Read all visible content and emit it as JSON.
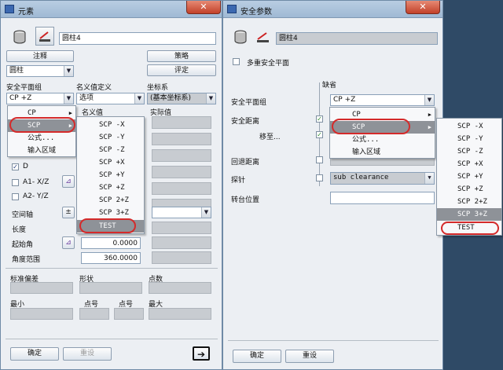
{
  "left_window": {
    "title": "元素",
    "close": "✕",
    "element_name": "圆柱4",
    "btn_note": "注释",
    "btn_strategy": "策略",
    "btn_eval": "评定",
    "type_select": "圆柱",
    "hdr_safety_plane_group": "安全平面组",
    "hdr_nominal_def": "名义值定义",
    "hdr_coord": "坐标系",
    "safety_plane_value": "CP +Z",
    "nominal_def_value": "选项",
    "coord_value": "(基本坐标系)",
    "col_nominal": "名义值",
    "col_actual": "实际值",
    "check_d": "D",
    "check_a1": "A1- X/Z",
    "check_a2": "A2- Y/Z",
    "label_axis": "空间轴",
    "axis_btn": "±",
    "label_length": "长度",
    "label_start_angle": "起始角",
    "start_angle_value": "0.0000",
    "label_angle_range": "角度范围",
    "angle_range_value": "360.0000",
    "label_std_dev": "标准偏差",
    "label_shape": "形状",
    "label_points": "点数",
    "label_min": "最小",
    "label_point_no1": "点号",
    "label_point_no2": "点号",
    "label_max": "最大",
    "btn_ok": "确定",
    "btn_reset": "重设",
    "menu1": [
      "CP",
      "SCP",
      "公式...",
      "输入区域"
    ],
    "menu2": [
      "SCP -X",
      "SCP -Y",
      "SCP -Z",
      "SCP +X",
      "SCP +Y",
      "SCP +Z",
      "SCP 2+Z",
      "SCP 3+Z",
      "TEST"
    ]
  },
  "right_window": {
    "title": "安全参数",
    "close": "✕",
    "element_name": "圆柱4",
    "multi_safety_plane": "多重安全平面",
    "default_label": "缺省",
    "label_safety_plane_group": "安全平面组",
    "safety_plane_value": "CP +Z",
    "label_safety_distance": "安全距离",
    "label_move_to": "移至...",
    "label_retract": "回退距离",
    "label_probe": "探针",
    "probe_value": "sub clearance",
    "label_rotate_pos": "转台位置",
    "btn_ok": "确定",
    "btn_reset": "重设",
    "menu1": [
      "CP",
      "SCP",
      "公式...",
      "输入区域"
    ],
    "menu2": [
      "SCP -X",
      "SCP -Y",
      "SCP -Z",
      "SCP +X",
      "SCP +Y",
      "SCP +Z",
      "SCP 2+Z",
      "SCP 3+Z",
      "TEST"
    ]
  },
  "colors": {
    "highlight": "#8e9298",
    "annotation": "#d42a2a",
    "titlebar": "#a9c1da"
  }
}
